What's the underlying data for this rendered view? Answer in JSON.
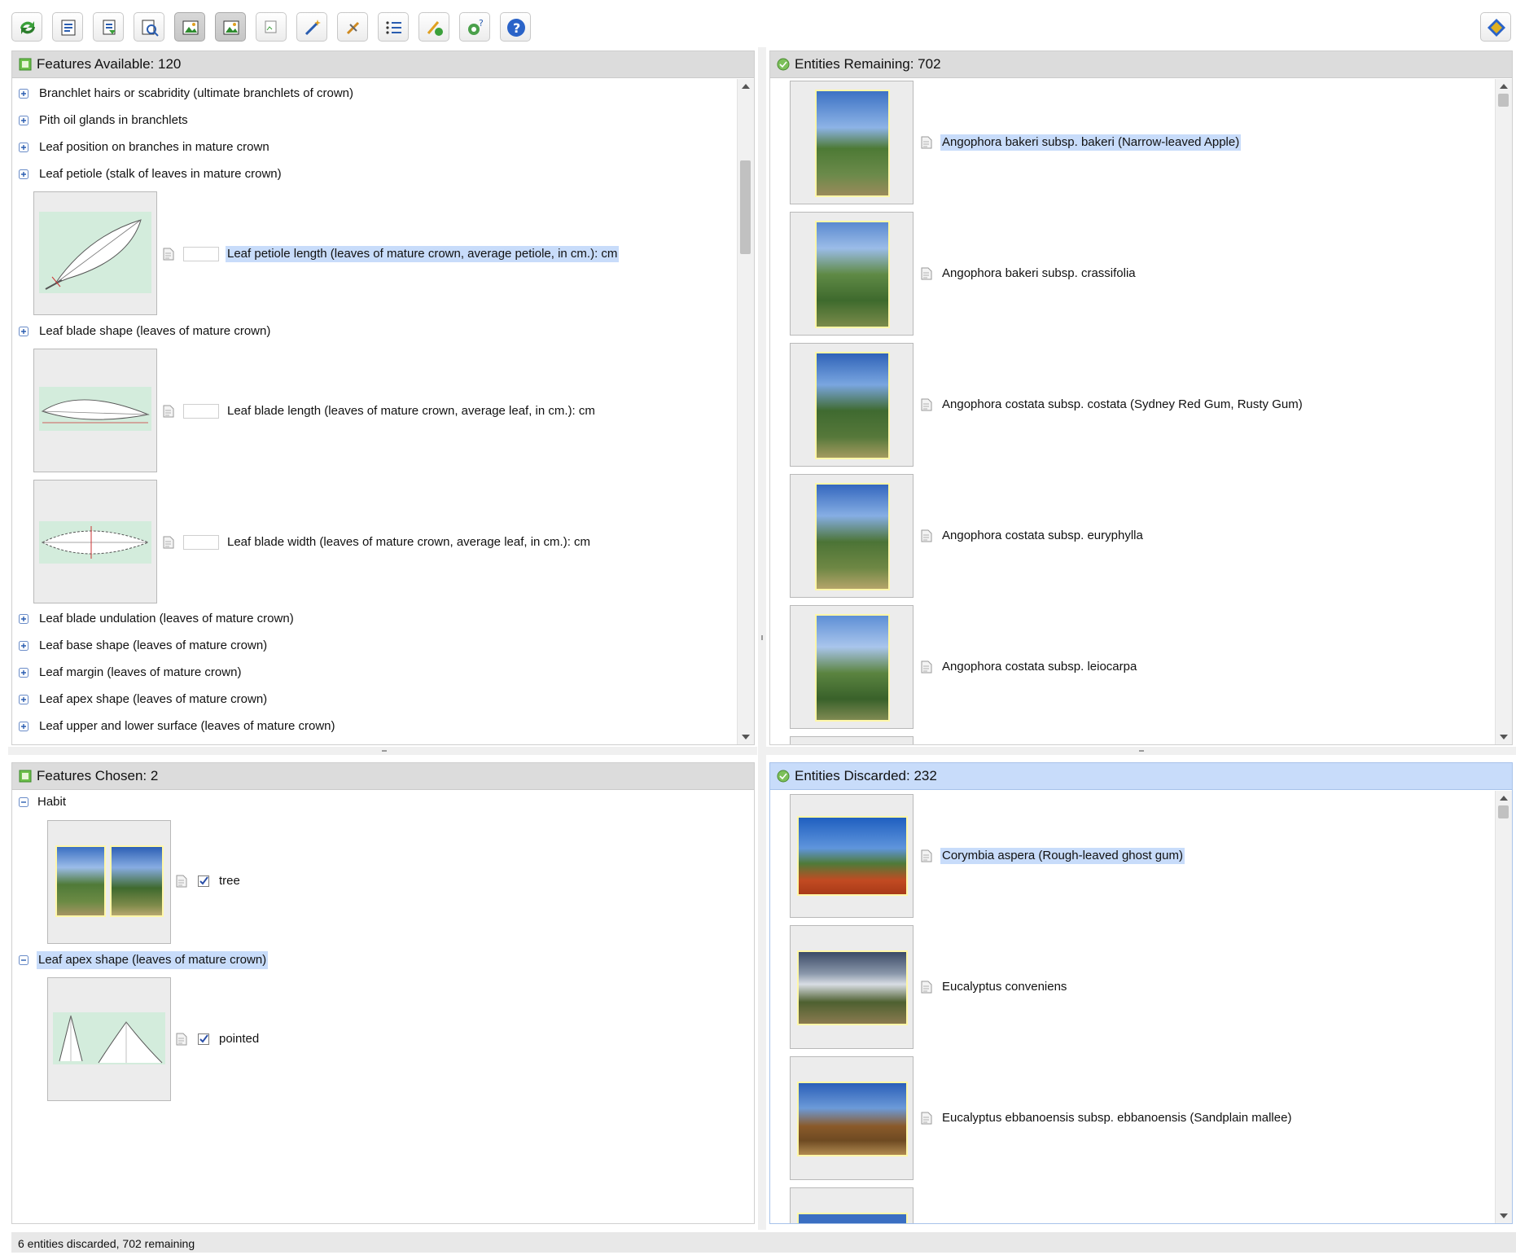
{
  "toolbar": {
    "buttons": [
      {
        "icon": "restart-icon"
      },
      {
        "icon": "features-list-icon"
      },
      {
        "icon": "sort-features-icon"
      },
      {
        "icon": "find-feature-icon"
      },
      {
        "icon": "image-view-icon"
      },
      {
        "icon": "image-view-alt-icon"
      },
      {
        "icon": "broken-image-icon"
      },
      {
        "icon": "magic-wand-icon"
      },
      {
        "icon": "prune-icon"
      },
      {
        "icon": "ordered-list-icon"
      },
      {
        "icon": "preferences-icon"
      },
      {
        "icon": "settings-help-icon"
      },
      {
        "icon": "help-icon"
      }
    ],
    "right_icon": "compass-icon"
  },
  "features_available": {
    "header": "Features Available: 120",
    "items": [
      {
        "type": "group",
        "label": "Branchlet hairs or scabridity (ultimate branchlets of crown)"
      },
      {
        "type": "group",
        "label": "Pith oil glands in branchlets"
      },
      {
        "type": "group",
        "label": "Leaf position on branches in mature crown"
      },
      {
        "type": "group",
        "label": "Leaf petiole (stalk of leaves in mature crown)"
      },
      {
        "type": "numeric",
        "label": "Leaf petiole length (leaves of mature crown, average petiole, in cm.): cm",
        "selected": true
      },
      {
        "type": "group",
        "label": "Leaf blade shape (leaves of mature crown)"
      },
      {
        "type": "numeric",
        "label": "Leaf blade length (leaves of mature crown, average leaf, in cm.): cm"
      },
      {
        "type": "numeric",
        "label": "Leaf blade width (leaves of mature crown, average leaf, in cm.): cm"
      },
      {
        "type": "group",
        "label": "Leaf blade undulation (leaves of mature crown)"
      },
      {
        "type": "group",
        "label": "Leaf base shape (leaves of mature crown)"
      },
      {
        "type": "group",
        "label": "Leaf margin (leaves of mature crown)"
      },
      {
        "type": "group",
        "label": "Leaf apex shape (leaves of mature crown)"
      },
      {
        "type": "group",
        "label": "Leaf upper and lower surface (leaves of mature crown)"
      }
    ]
  },
  "entities_remaining": {
    "header": "Entities Remaining: 702",
    "items": [
      {
        "label": "Angophora bakeri subsp. bakeri (Narrow-leaved Apple)",
        "selected": true
      },
      {
        "label": "Angophora bakeri subsp. crassifolia"
      },
      {
        "label": "Angophora costata subsp. costata (Sydney Red Gum, Rusty Gum)"
      },
      {
        "label": "Angophora costata subsp. euryphylla"
      },
      {
        "label": "Angophora costata subsp. leiocarpa"
      }
    ]
  },
  "features_chosen": {
    "header": "Features Chosen: 2",
    "groups": [
      {
        "label": "Habit",
        "value": "tree",
        "checked": true
      },
      {
        "label": "Leaf apex shape (leaves of mature crown)",
        "value": "pointed",
        "checked": true,
        "selected": true
      }
    ]
  },
  "entities_discarded": {
    "header": "Entities Discarded: 232",
    "items": [
      {
        "label": "Corymbia aspera (Rough-leaved ghost gum)",
        "selected": true
      },
      {
        "label": "Eucalyptus conveniens"
      },
      {
        "label": "Eucalyptus ebbanoensis subsp. ebbanoensis (Sandplain mallee)"
      }
    ]
  },
  "status": "6 entities discarded, 702 remaining",
  "colors": {
    "selection": "#c8dcfa",
    "header": "#dcdcdc",
    "active_header": "#c8dcfa",
    "leaf_bg": "#d3ecdc"
  }
}
